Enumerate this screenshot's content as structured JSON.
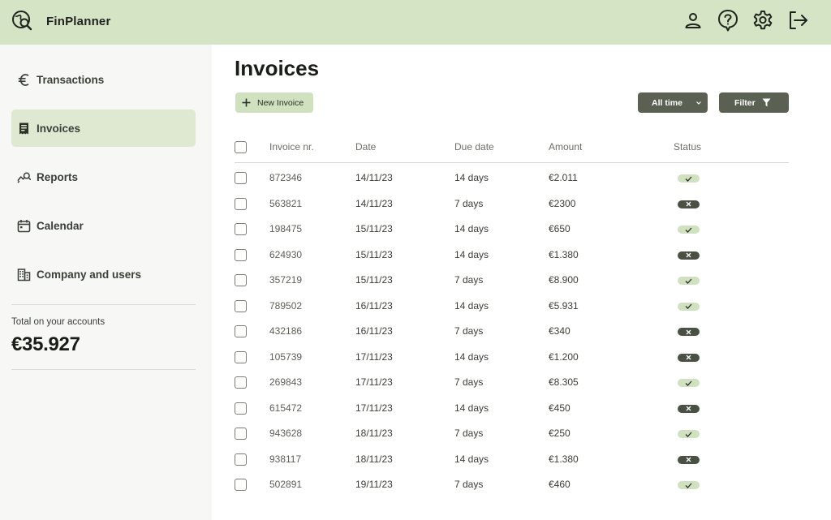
{
  "app": {
    "name": "FinPlanner"
  },
  "sidebar": {
    "items": [
      {
        "label": "Transactions",
        "icon": "euro-icon",
        "active": false
      },
      {
        "label": "Invoices",
        "icon": "receipt-icon",
        "active": true
      },
      {
        "label": "Reports",
        "icon": "chart-search-icon",
        "active": false
      },
      {
        "label": "Calendar",
        "icon": "calendar-icon",
        "active": false
      },
      {
        "label": "Company and users",
        "icon": "building-icon",
        "active": false
      }
    ],
    "total_label": "Total on your accounts",
    "total_value": "€35.927"
  },
  "main": {
    "title": "Invoices",
    "new_invoice_label": "New Invoice",
    "period_label": "All time",
    "filter_label": "Filter"
  },
  "table": {
    "columns": [
      "Invoice nr.",
      "Date",
      "Due date",
      "Amount",
      "Status"
    ],
    "rows": [
      {
        "invoice": "872346",
        "date": "14/11/23",
        "due": "14 days",
        "amount": "€2.011",
        "status": "paid"
      },
      {
        "invoice": "563821",
        "date": "14/11/23",
        "due": "7 days",
        "amount": "€2300",
        "status": "unpaid"
      },
      {
        "invoice": "198475",
        "date": "15/11/23",
        "due": "14 days",
        "amount": "€650",
        "status": "paid"
      },
      {
        "invoice": "624930",
        "date": "15/11/23",
        "due": "14 days",
        "amount": "€1.380",
        "status": "unpaid"
      },
      {
        "invoice": "357219",
        "date": "15/11/23",
        "due": "7 days",
        "amount": "€8.900",
        "status": "paid"
      },
      {
        "invoice": "789502",
        "date": "16/11/23",
        "due": "14 days",
        "amount": "€5.931",
        "status": "paid"
      },
      {
        "invoice": "432186",
        "date": "16/11/23",
        "due": "7 days",
        "amount": "€340",
        "status": "unpaid"
      },
      {
        "invoice": "105739",
        "date": "17/11/23",
        "due": "14 days",
        "amount": "€1.200",
        "status": "unpaid"
      },
      {
        "invoice": "269843",
        "date": "17/11/23",
        "due": "7 days",
        "amount": "€8.305",
        "status": "paid"
      },
      {
        "invoice": "615472",
        "date": "17/11/23",
        "due": "14 days",
        "amount": "€450",
        "status": "unpaid"
      },
      {
        "invoice": "943628",
        "date": "18/11/23",
        "due": "7 days",
        "amount": "€250",
        "status": "paid"
      },
      {
        "invoice": "938117",
        "date": "18/11/23",
        "due": "14 days",
        "amount": "€1.380",
        "status": "unpaid"
      },
      {
        "invoice": "502891",
        "date": "19/11/23",
        "due": "7 days",
        "amount": "€460",
        "status": "paid"
      }
    ]
  },
  "colors": {
    "topbar": "#d5e4c4",
    "accent_light": "#cfe1bf",
    "accent_dark": "#5a6152",
    "sidebar_bg": "#f7f7f5"
  },
  "top_icons": [
    "user-icon",
    "help-icon",
    "gear-icon",
    "logout-icon"
  ]
}
